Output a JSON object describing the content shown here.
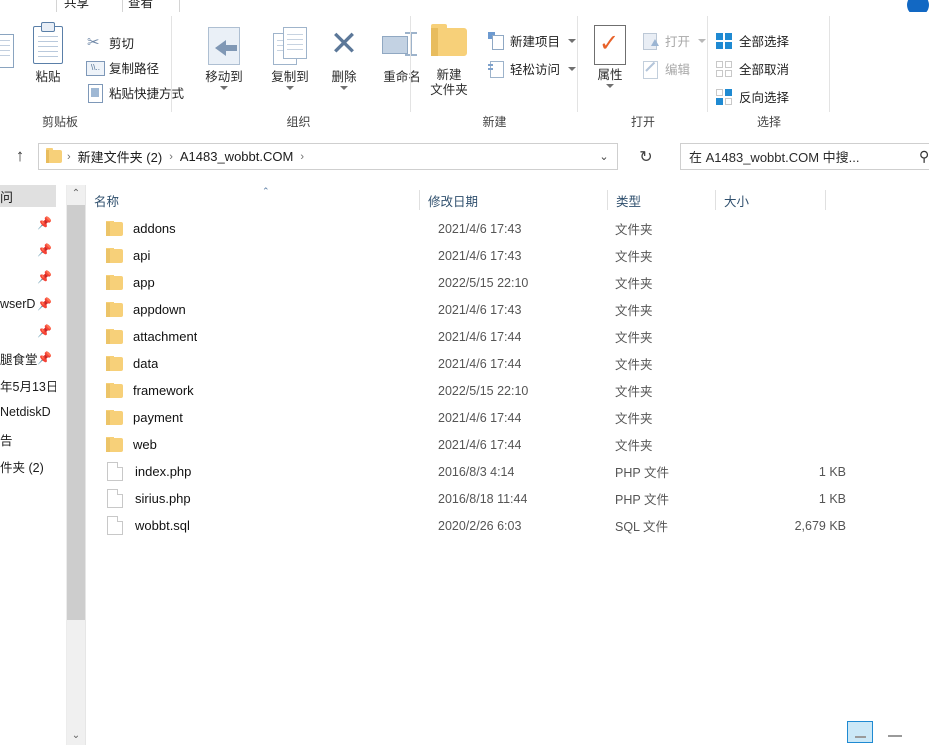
{
  "window": {
    "tabs": [
      {
        "label": "共享",
        "name": "tab-share"
      },
      {
        "label": "查看",
        "name": "tab-view"
      }
    ]
  },
  "ribbon": {
    "groups": [
      {
        "id": "clipboard",
        "label": "剪贴板",
        "big_buttons": [
          {
            "label": "粘贴",
            "icon": "clipboard-icon"
          }
        ],
        "small_buttons": [
          {
            "label": "剪切",
            "icon": "scissors-icon",
            "has_caret": false
          },
          {
            "label": "复制路径",
            "icon": "copy-path-icon",
            "has_caret": false
          },
          {
            "label": "粘贴快捷方式",
            "icon": "paste-shortcut-icon",
            "has_caret": false
          }
        ]
      },
      {
        "id": "organize",
        "label": "组织",
        "big_buttons": [
          {
            "label": "移动到",
            "icon": "move-to-icon",
            "has_caret": true
          },
          {
            "label": "复制到",
            "icon": "copy-to-icon",
            "has_caret": true
          },
          {
            "label": "删除",
            "icon": "delete-x-icon",
            "has_caret": true
          },
          {
            "label": "重命名",
            "icon": "rename-icon",
            "has_caret": false
          }
        ]
      },
      {
        "id": "new",
        "label": "新建",
        "big_buttons": [
          {
            "label": "新建\n文件夹",
            "label_line1": "新建",
            "label_line2": "文件夹",
            "icon": "new-folder-icon"
          }
        ],
        "small_buttons": [
          {
            "label": "新建项目",
            "icon": "new-item-icon",
            "has_caret": true
          },
          {
            "label": "轻松访问",
            "icon": "easy-access-icon",
            "has_caret": true
          }
        ]
      },
      {
        "id": "open",
        "label": "打开",
        "big_buttons": [
          {
            "label": "属性",
            "icon": "properties-icon",
            "has_caret": true
          }
        ],
        "small_buttons": [
          {
            "label": "打开",
            "icon": "open-icon",
            "has_caret": true,
            "disabled": true
          },
          {
            "label": "编辑",
            "icon": "edit-icon",
            "has_caret": false,
            "disabled": true
          }
        ]
      },
      {
        "id": "select",
        "label": "选择",
        "small_buttons": [
          {
            "label": "全部选择",
            "icon": "select-all-icon"
          },
          {
            "label": "全部取消",
            "icon": "select-none-icon"
          },
          {
            "label": "反向选择",
            "icon": "invert-selection-icon"
          }
        ]
      }
    ]
  },
  "address": {
    "up_icon": "up-arrow-icon",
    "folder_icon": "folder-icon",
    "crumbs": [
      "新建文件夹 (2)",
      "A1483_wobbt.COM"
    ],
    "separator": "›",
    "dropdown_icon": "chevron-down-icon",
    "refresh_icon": "refresh-icon",
    "search_value": "在 A1483_wobbt.COM 中搜...",
    "search_icon": "search-icon"
  },
  "nav_pane": {
    "items": [
      {
        "label": "问",
        "selected": true,
        "pinned": false
      },
      {
        "label": "",
        "selected": false,
        "pinned": true
      },
      {
        "label": "",
        "selected": false,
        "pinned": true
      },
      {
        "label": "",
        "selected": false,
        "pinned": true
      },
      {
        "label": "wserD",
        "selected": false,
        "pinned": true
      },
      {
        "label": "",
        "selected": false,
        "pinned": true
      },
      {
        "label": "腿食堂",
        "selected": false,
        "pinned": true
      },
      {
        "label": "年5月13日",
        "selected": false,
        "pinned": false
      },
      {
        "label": "NetdiskD",
        "selected": false,
        "pinned": false
      },
      {
        "label": "告",
        "selected": false,
        "pinned": false
      },
      {
        "label": "件夹 (2)",
        "selected": false,
        "pinned": false
      }
    ],
    "scroll_up_icon": "chevron-up-icon",
    "scroll_down_icon": "chevron-down-icon"
  },
  "file_list": {
    "columns": [
      {
        "label": "名称",
        "key": "name",
        "sorted": true,
        "sort_dir": "asc"
      },
      {
        "label": "修改日期",
        "key": "date"
      },
      {
        "label": "类型",
        "key": "type"
      },
      {
        "label": "大小",
        "key": "size"
      }
    ],
    "rows": [
      {
        "name": "addons",
        "date": "2021/4/6 17:43",
        "type": "文件夹",
        "size": "",
        "icon": "folder-icon"
      },
      {
        "name": "api",
        "date": "2021/4/6 17:43",
        "type": "文件夹",
        "size": "",
        "icon": "folder-icon"
      },
      {
        "name": "app",
        "date": "2022/5/15 22:10",
        "type": "文件夹",
        "size": "",
        "icon": "folder-icon"
      },
      {
        "name": "appdown",
        "date": "2021/4/6 17:43",
        "type": "文件夹",
        "size": "",
        "icon": "folder-icon"
      },
      {
        "name": "attachment",
        "date": "2021/4/6 17:44",
        "type": "文件夹",
        "size": "",
        "icon": "folder-icon"
      },
      {
        "name": "data",
        "date": "2021/4/6 17:44",
        "type": "文件夹",
        "size": "",
        "icon": "folder-icon"
      },
      {
        "name": "framework",
        "date": "2022/5/15 22:10",
        "type": "文件夹",
        "size": "",
        "icon": "folder-icon"
      },
      {
        "name": "payment",
        "date": "2021/4/6 17:44",
        "type": "文件夹",
        "size": "",
        "icon": "folder-icon"
      },
      {
        "name": "web",
        "date": "2021/4/6 17:44",
        "type": "文件夹",
        "size": "",
        "icon": "folder-icon"
      },
      {
        "name": "index.php",
        "date": "2016/8/3 4:14",
        "type": "PHP 文件",
        "size": "1 KB",
        "icon": "file-icon"
      },
      {
        "name": "sirius.php",
        "date": "2016/8/18 11:44",
        "type": "PHP 文件",
        "size": "1 KB",
        "icon": "file-icon"
      },
      {
        "name": "wobbt.sql",
        "date": "2020/2/26 6:03",
        "type": "SQL 文件",
        "size": "2,679 KB",
        "icon": "file-icon"
      }
    ]
  },
  "status_bar": {
    "view_buttons": [
      {
        "name": "details-view-button",
        "active": true
      },
      {
        "name": "large-icons-view-button",
        "active": false
      }
    ]
  },
  "colors": {
    "accent": "#1f8ad2",
    "folder": "#f7d079",
    "header_text": "#30506e",
    "check_orange": "#e8622a",
    "selection": "#e0e0e0"
  }
}
